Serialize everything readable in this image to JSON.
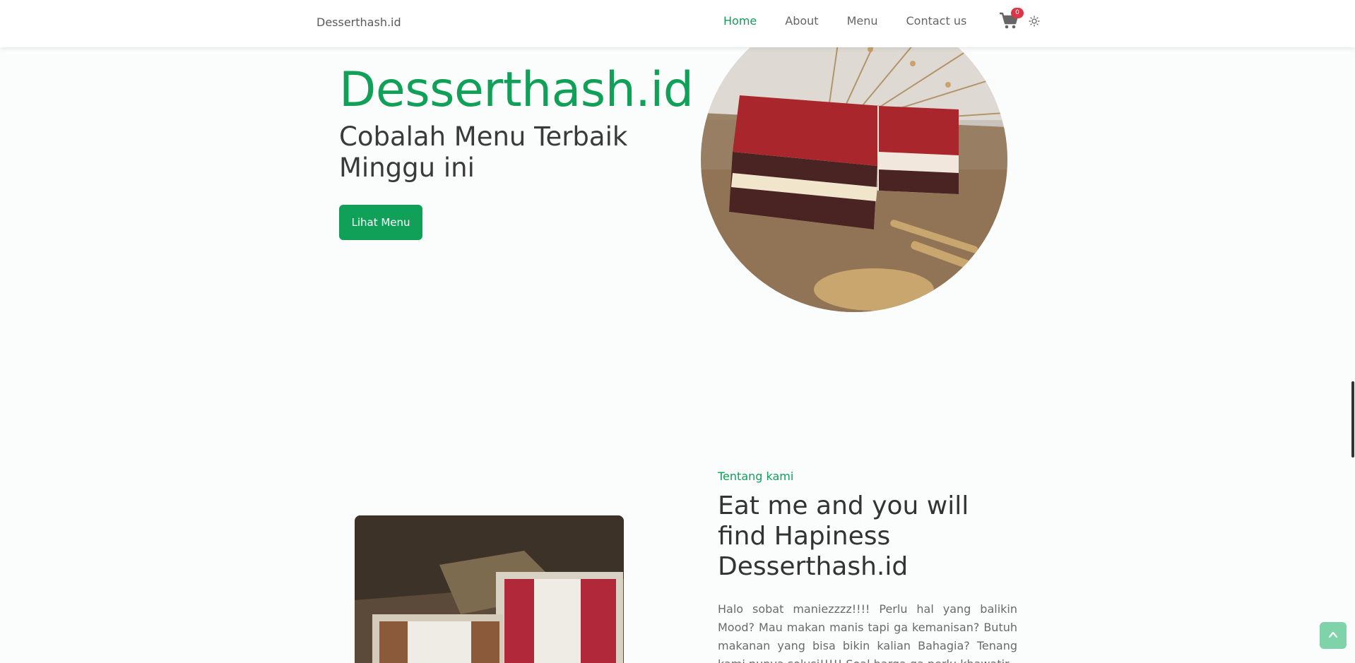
{
  "navbar": {
    "brand": "Desserthash.id",
    "links": [
      {
        "label": "Home",
        "active": true
      },
      {
        "label": "About",
        "active": false
      },
      {
        "label": "Menu",
        "active": false
      },
      {
        "label": "Contact us",
        "active": false
      }
    ],
    "cart_count": "0",
    "cart_icon": "cart-icon",
    "theme_icon": "sun-icon"
  },
  "hero": {
    "title": "Desserthash.id",
    "subtitle": "Cobalah Menu Terbaik Minggu ini",
    "button_label": "Lihat Menu"
  },
  "about": {
    "eyebrow": "Tentang kami",
    "title": "Eat me and you will find Hapiness Desserthash.id",
    "text": "Halo sobat maniezzzz!!!! Perlu hal yang balikin Mood? Mau makan manis tapi ga kemanisan? Butuh makanan yang bisa bikin kalian Bahagia? Tenang kami punya solusi!!!!! Soal harga ga perlu khawatir"
  },
  "colors": {
    "accent": "#10a058",
    "badge": "#dc3545",
    "back_to_top": "#7fd3a8"
  },
  "back_to_top_icon": "chevron-up-icon"
}
